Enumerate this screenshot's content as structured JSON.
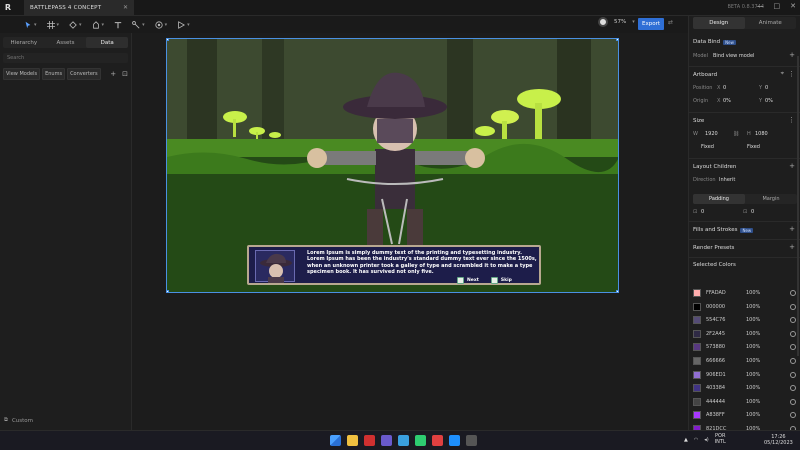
{
  "window": {
    "tab_title": "BATTLEPASS 4 CONCEPT",
    "tab_close": "✕",
    "version": "BETA 0.8.3744",
    "controls": [
      "—",
      "□",
      "✕"
    ]
  },
  "toolbar": {
    "zoom": "57%",
    "export_label": "Export",
    "icons": [
      "select-tool-icon",
      "frame-tool-icon",
      "pen-tool-icon",
      "shape-tool-icon",
      "text-tool-icon",
      "bone-tool-icon",
      "component-tool-icon",
      "play-tool-icon"
    ]
  },
  "left_panel": {
    "tabs": [
      "Hierarchy",
      "Assets",
      "Data"
    ],
    "active_tab": "Data",
    "search_placeholder": "Search",
    "chips": [
      "View Models",
      "Enums",
      "Converters"
    ],
    "footer_label": "Custom"
  },
  "canvas": {
    "dialog_text": "Lorem Ipsum is simply dummy text of the printing and typesetting industry. Lorem Ipsum has been the industry's standard dummy text ever since the 1500s, when an unknown printer took a galley of type and scrambled it to make a type specimen book. It has survived not only five.",
    "next_label": "Next",
    "skip_label": "Skip"
  },
  "right_panel": {
    "tabs": [
      "Design",
      "Animate"
    ],
    "active_tab": "Design",
    "data_bind": {
      "title": "Data Bind",
      "badge": "New",
      "model_label": "Model",
      "model_value": "Bind view model"
    },
    "artboard": {
      "title": "Artboard",
      "position_label": "Position",
      "x_label": "X",
      "x_value": "0",
      "y_label": "Y",
      "y_value": "0",
      "origin_label": "Origin",
      "ox_value": "0%",
      "oy_value": "0%"
    },
    "size": {
      "title": "Size",
      "w_label": "W",
      "w_value": "1920",
      "h_label": "H",
      "h_value": "1080",
      "w_mode": "Fixed",
      "h_mode": "Fixed"
    },
    "layout_children": {
      "title": "Layout Children",
      "direction_label": "Direction",
      "direction_value": "Inherit"
    },
    "padding": {
      "tabs": [
        "Padding",
        "Margin"
      ],
      "active": "Padding",
      "left_value": "0",
      "right_value": "0"
    },
    "fills_strokes": {
      "title": "Fills and Strokes",
      "badge": "New"
    },
    "render_presets": {
      "title": "Render Presets"
    },
    "selected_colors": {
      "title": "Selected Colors",
      "items": [
        {
          "hex": "FFADAD",
          "pct": "100%",
          "color": "#FFADAD"
        },
        {
          "hex": "000000",
          "pct": "100%",
          "color": "#000000"
        },
        {
          "hex": "554C76",
          "pct": "100%",
          "color": "#554C76"
        },
        {
          "hex": "2F2A45",
          "pct": "100%",
          "color": "#2F2A45"
        },
        {
          "hex": "573880",
          "pct": "100%",
          "color": "#573880"
        },
        {
          "hex": "666666",
          "pct": "100%",
          "color": "#666666"
        },
        {
          "hex": "906ED1",
          "pct": "100%",
          "color": "#906ED1"
        },
        {
          "hex": "403384",
          "pct": "100%",
          "color": "#403384"
        },
        {
          "hex": "444444",
          "pct": "100%",
          "color": "#444444"
        },
        {
          "hex": "A838FF",
          "pct": "100%",
          "color": "#A838FF"
        },
        {
          "hex": "821DCC",
          "pct": "100%",
          "color": "#821DCC"
        },
        {
          "hex": "DAC3D8",
          "pct": "100%",
          "color": "#DAC3D8"
        }
      ]
    }
  },
  "taskbar": {
    "lang_top": "POR",
    "lang_bottom": "INTL",
    "time": "17:26",
    "date": "05/12/2023",
    "tray_chevron": "▲",
    "app_colors": [
      "#3a7bd5",
      "#f0c040",
      "#d03030",
      "#6a5acd",
      "#3aa0e0",
      "#2ecc71",
      "#e04040",
      "#1e90ff",
      "#555555"
    ]
  }
}
